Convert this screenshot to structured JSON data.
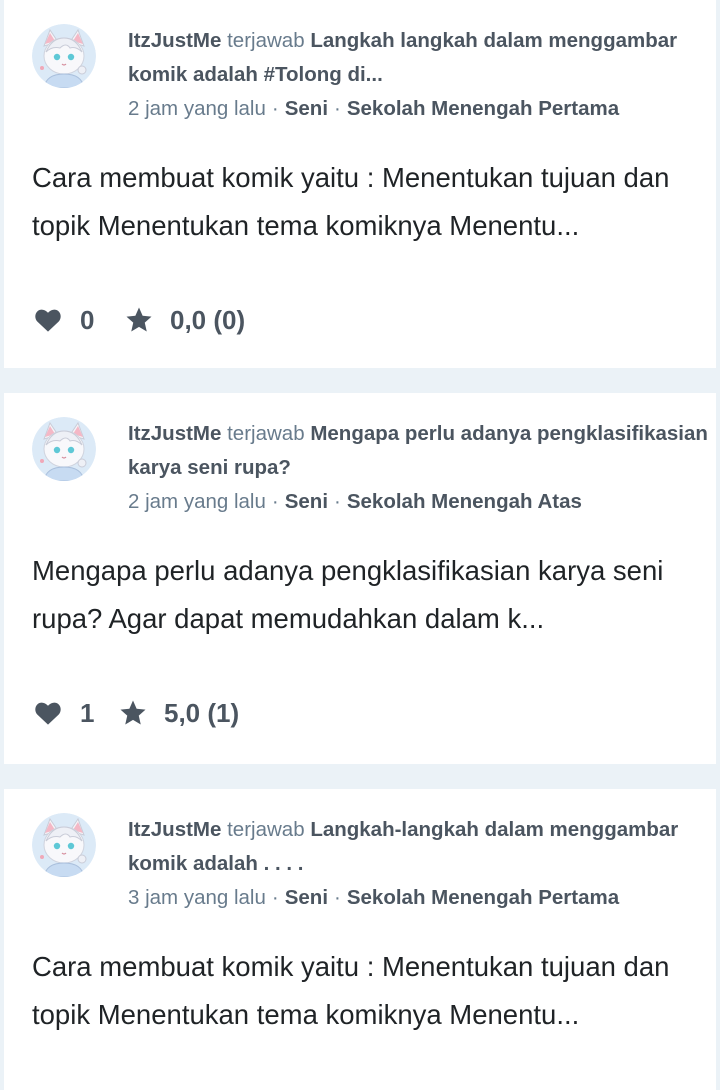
{
  "colors": {
    "page_bg": "#ebf2f7",
    "card_bg": "#ffffff",
    "text_dark": "#1f2326",
    "text_meta": "#687b8c",
    "text_bold": "#4b5560"
  },
  "answers": [
    {
      "author": "ItzJustMe",
      "verb": "terjawab",
      "question": "Langkah langkah dalam menggambar komik adalah #Tolong di...",
      "time": "2 jam yang lalu",
      "separator": "·",
      "subject": "Seni",
      "level": "Sekolah Menengah Pertama",
      "answer_text": "Cara membuat komik yaitu : Menentukan tujuan dan topik Menentukan tema komiknya Menentu...",
      "thanks": "0",
      "rating": "0,0 (0)",
      "icons": {
        "avatar": "avatar-icon",
        "thanks": "heart-icon",
        "rating": "star-icon"
      }
    },
    {
      "author": "ItzJustMe",
      "verb": "terjawab",
      "question": "Mengapa perlu adanya pengklasifikasian karya seni rupa?",
      "time": "2 jam yang lalu",
      "separator": "·",
      "subject": "Seni",
      "level": "Sekolah Menengah Atas",
      "answer_text": "Mengapa perlu adanya pengklasifikasian karya seni rupa? Agar dapat memudahkan dalam k...",
      "thanks": "1",
      "rating": "5,0 (1)",
      "icons": {
        "avatar": "avatar-icon",
        "thanks": "heart-icon",
        "rating": "star-icon"
      }
    },
    {
      "author": "ItzJustMe",
      "verb": "terjawab",
      "question": "Langkah-langkah dalam menggambar komik adalah . . . .",
      "time": "3 jam yang lalu",
      "separator": "·",
      "subject": "Seni",
      "level": "Sekolah Menengah Pertama",
      "answer_text": "Cara membuat komik yaitu : Menentukan tujuan dan topik Menentukan tema komiknya Menentu...",
      "icons": {
        "avatar": "avatar-icon"
      }
    }
  ]
}
